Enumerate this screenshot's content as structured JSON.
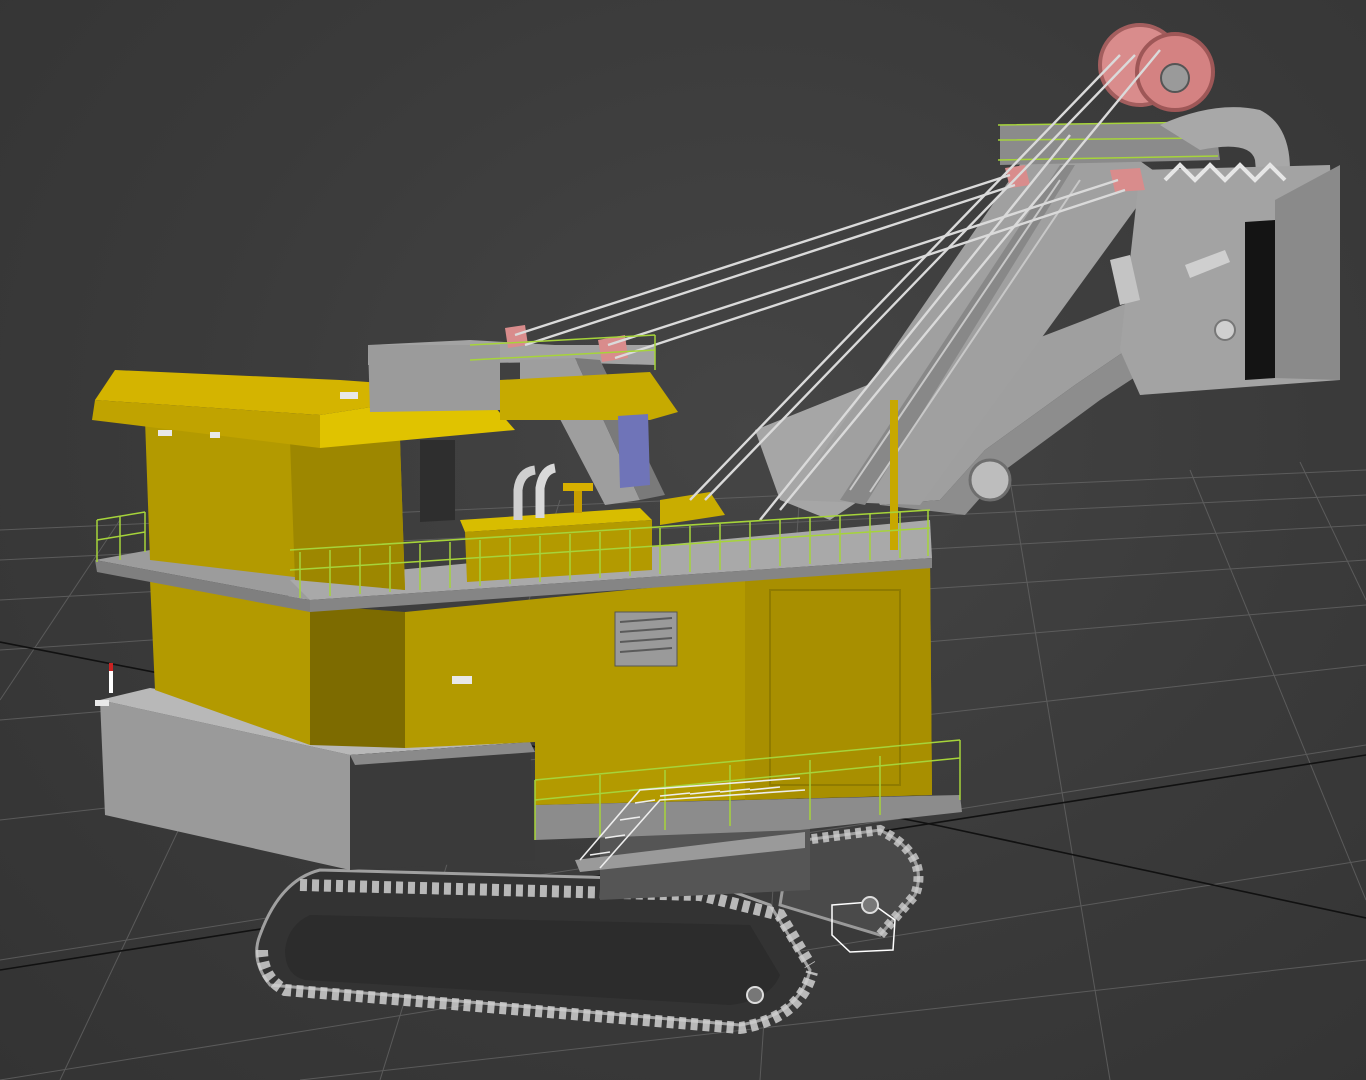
{
  "viewport": {
    "background_color": "#3c3c3c",
    "grid_color": "#6a6a6a",
    "axis_color": "#111111"
  },
  "model": {
    "body_color": "#b39a00",
    "body_shade_color": "#8f7b00",
    "roof_color": "#d4b400",
    "steel_color": "#a8a8a8",
    "steel_dark_color": "#6f6f6f",
    "sheave_color": "#d98c8c",
    "railing_color": "#a6d43a",
    "selection_color": "#ffffff",
    "icons": [
      "shovel-model",
      "boom",
      "dipper-bucket",
      "crawler-tracks",
      "cab",
      "railings",
      "sheave-wheels"
    ]
  }
}
